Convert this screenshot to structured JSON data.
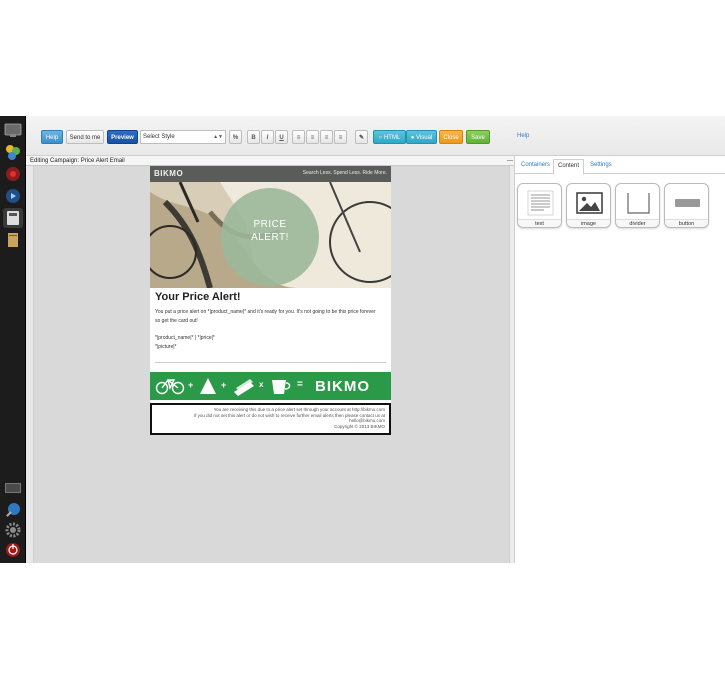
{
  "toolbar": {
    "help": "Help",
    "send_to_me": "Send to me",
    "preview": "Preview",
    "style_select": "Select Style",
    "link_icon": "%",
    "bold": "B",
    "italic": "I",
    "underline": "U",
    "html_toggle": "HTML",
    "visual_toggle": "Visual",
    "close": "Close",
    "save": "Save",
    "help_link": "Help"
  },
  "status": {
    "editing": "Editing Campaign: Price Alert Email",
    "collapse": "—"
  },
  "email": {
    "logo": "BIKMO",
    "tagline": "Search Less. Spend Less. Ride More.",
    "hero_title_line1": "PRICE",
    "hero_title_line2": "ALERT!",
    "heading": "Your Price Alert!",
    "body_line1": "You put a price alert on *|product_name|* and it's ready for you. It's not going to be this price forever",
    "body_line2": "so get the card out!",
    "product_line": "*|product_name|* | *|price|*",
    "picture_line": "*|picture|*",
    "banner_plus1": "+",
    "banner_plus2": "+",
    "banner_times": "x",
    "banner_equals": "=",
    "banner_logo": "BIKMO",
    "footer_line1": "You are receiving this due to a price alert set through your account at http://bikmo.com",
    "footer_line2": "If you did not set this alert or do not wish to receive further email alerts then please contact us at",
    "footer_line3": "hello@bikmo.com",
    "footer_line4": "Copyright © 2013 BIKMO"
  },
  "panel": {
    "tabs": [
      "Containers",
      "Content",
      "Settings"
    ],
    "active_tab": "Content",
    "blocks": [
      {
        "label": "text",
        "icon": "text-block-icon"
      },
      {
        "label": "image",
        "icon": "image-block-icon"
      },
      {
        "label": "divider",
        "icon": "divider-block-icon"
      },
      {
        "label": "button",
        "icon": "button-block-icon"
      }
    ]
  },
  "colors": {
    "banner_green": "#2a9a48",
    "header_gray": "#595c59",
    "hero_circle": "#9bb89a",
    "toolbar_save": "#5fb234",
    "toolbar_close": "#ee9817"
  }
}
